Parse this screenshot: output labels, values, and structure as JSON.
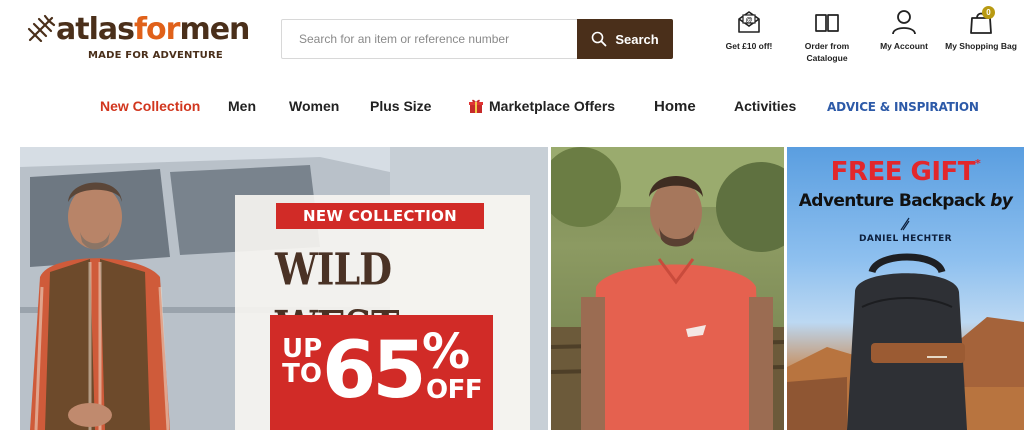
{
  "header": {
    "logo": {
      "part1": "atlas",
      "part2": "for",
      "part3": "men",
      "tagline": "MADE FOR ADVENTURE",
      "icon": "pine-branch-icon"
    },
    "search": {
      "placeholder": "Search for an item or reference number",
      "value": "",
      "button_label": "Search",
      "icon": "search-icon"
    },
    "utilities": [
      {
        "label": "Get £10 off!",
        "icon": "email-offer-icon"
      },
      {
        "label": "Order from Catalogue",
        "icon": "open-book-icon"
      },
      {
        "label": "My Account",
        "icon": "user-icon"
      },
      {
        "label": "My Shopping Bag",
        "icon": "shopping-bag-icon",
        "badge": "0"
      }
    ]
  },
  "nav": {
    "items": [
      {
        "label": "New Collection",
        "color": "#d1361e"
      },
      {
        "label": "Men"
      },
      {
        "label": "Women"
      },
      {
        "label": "Plus Size"
      },
      {
        "label": "Marketplace Offers",
        "icon": "gift-icon"
      },
      {
        "label": "Home"
      },
      {
        "label": "Activities"
      },
      {
        "label": "ADVICE & INSPIRATION",
        "color": "#2d5aa8"
      }
    ]
  },
  "banners": {
    "promo": {
      "tag": "NEW COLLECTION",
      "title": "WILD WEST",
      "upto_line1": "UP",
      "upto_line2": "TO",
      "percent": "65",
      "percent_sign": "%",
      "off": "OFF"
    },
    "tshirt": {},
    "gift": {
      "title": "FREE GIFT",
      "asterisk": "*",
      "subtitle": "Adventure Backpack",
      "subtitle_by": "by",
      "brand": "DANIEL HECHTER"
    }
  },
  "colors": {
    "brand_brown": "#4a2f1a",
    "brand_orange": "#e0611a",
    "promo_red": "#d12b27",
    "badge_gold": "#b89a12"
  }
}
